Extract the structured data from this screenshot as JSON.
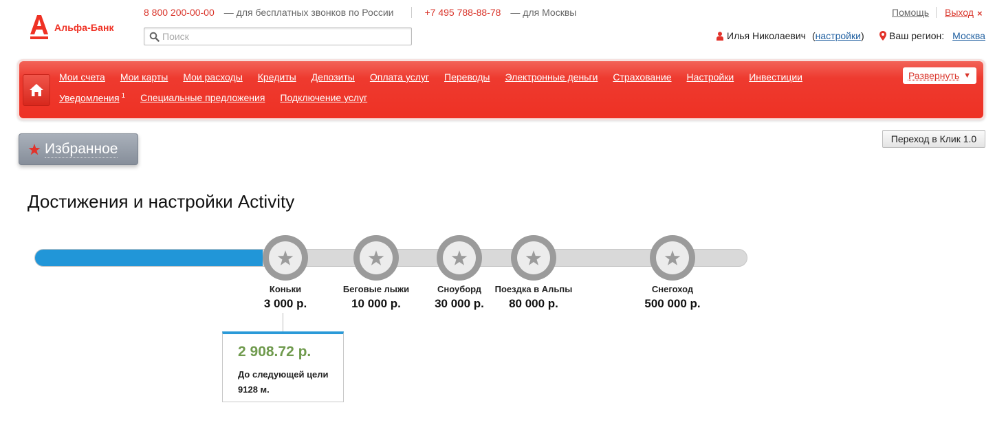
{
  "header": {
    "logo_text": "Альфа-Банк",
    "phone_free": "8 800 200-00-00",
    "phone_free_desc": "— для бесплатных звонков по России",
    "phone_moscow": "+7 495 788-88-78",
    "phone_moscow_desc": "— для Москвы",
    "search_placeholder": "Поиск",
    "help_label": "Помощь",
    "logout_label": "Выход",
    "logout_icon": "×",
    "user_name": "Илья Николаевич",
    "settings_label": "настройки",
    "region_label": "Ваш регион:",
    "region_city": "Москва",
    "accent_color": "#ef3124"
  },
  "nav": {
    "row1": [
      "Мои счета",
      "Мои карты",
      "Мои расходы",
      "Кредиты",
      "Депозиты",
      "Оплата услуг",
      "Переводы",
      "Электронные деньги",
      "Страхование",
      "Настройки",
      "Инвестиции"
    ],
    "row2_notifications": "Уведомления",
    "row2_notifications_badge": "1",
    "row2_offers": "Специальные предложения",
    "row2_services": "Подключение услуг",
    "expand_label": "Развернуть",
    "expand_arrow": "▼"
  },
  "favorites_label": "Избранное",
  "klik_button_label": "Переход в Клик 1.0",
  "page_title": "Достижения и настройки Activity",
  "progress": {
    "fill_fraction": 0.32,
    "fill_color": "#2196d8",
    "goals": [
      {
        "name": "Коньки",
        "amount": "3 000 р."
      },
      {
        "name": "Беговые лыжи",
        "amount": "10 000 р."
      },
      {
        "name": "Сноуборд",
        "amount": "30 000 р."
      },
      {
        "name": "Поездка в Альпы",
        "amount": "80 000 р."
      },
      {
        "name": "Снегоход",
        "amount": "500 000 р."
      }
    ]
  },
  "info_box": {
    "sum": "2 908.72 р.",
    "text_line1": "До следующей цели",
    "text_line2": "9128 м."
  }
}
